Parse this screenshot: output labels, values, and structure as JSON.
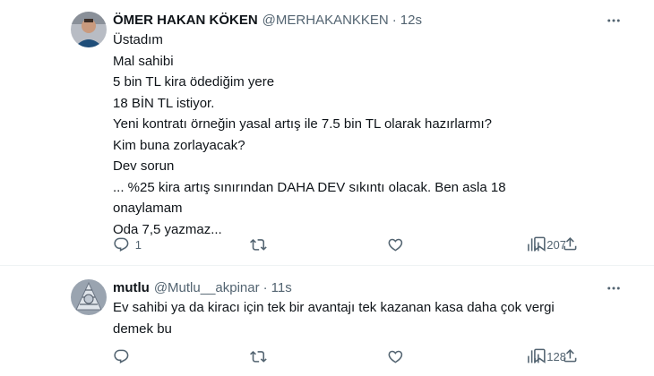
{
  "colors": {
    "text": "#0f1419",
    "secondary": "#536471",
    "divider": "#eff3f4"
  },
  "tweets": [
    {
      "name": "ÖMER HAKAN KÖKEN",
      "handle": "@MERHAKANKKEN",
      "separator": "·",
      "time": "12s",
      "avatar_icon": "profile-photo",
      "lines": [
        "Üstadım",
        "Mal sahibi",
        "5 bin TL kira ödediğim yere",
        "18 BİN TL istiyor.",
        "Yeni kontratı örneğin yasal artış ile 7.5 bin TL olarak hazırlarmı?",
        "Kim buna zorlayacak?",
        "Dev sorun",
        "... %25 kira artış sınırından DAHA DEV sıkıntı olacak. Ben asla 18",
        "onaylamam",
        "Oda 7,5 yazmaz..."
      ],
      "replies": "1",
      "retweets": "",
      "likes": "",
      "views": "207"
    },
    {
      "name": "mutlu",
      "handle": "@Mutlu__akpinar",
      "separator": "·",
      "time": "11s",
      "avatar_icon": "profile-photo",
      "lines": [
        "Ev sahibi ya da kiracı  için tek bir avantajı  tek kazanan kasa daha çok vergi",
        "demek bu"
      ],
      "replies": "",
      "retweets": "",
      "likes": "",
      "views": "128"
    }
  ]
}
